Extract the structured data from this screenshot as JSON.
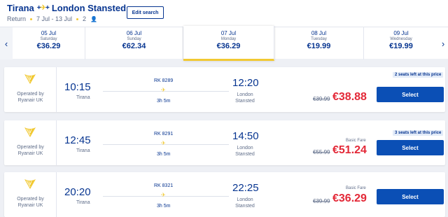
{
  "header": {
    "origin": "Tirana",
    "destination": "London Stansted",
    "trip_type": "Return",
    "dates": "7 Jul - 13 Jul",
    "passengers": "2",
    "edit_label": "Edit search"
  },
  "dates": [
    {
      "date": "05 Jul",
      "weekday": "Saturday",
      "price": "€36.29"
    },
    {
      "date": "06 Jul",
      "weekday": "Sunday",
      "price": "€62.34"
    },
    {
      "date": "07 Jul",
      "weekday": "Monday",
      "price": "€36.29",
      "active": true
    },
    {
      "date": "08 Jul",
      "weekday": "Tuesday",
      "price": "€19.99"
    },
    {
      "date": "09 Jul",
      "weekday": "Wednesday",
      "price": "€19.99"
    }
  ],
  "flights": [
    {
      "operated_line1": "Operated by",
      "operated_line2": "Ryanair UK",
      "dep_time": "10:15",
      "dep_city": "Tirana",
      "flight_no": "RK 8289",
      "duration": "3h 5m",
      "arr_time": "12:20",
      "arr_city": "London Stansted",
      "fare_label": "",
      "old_price": "€39.99",
      "new_price": "€38.88",
      "seats_left": "2 seats left at this price",
      "select_label": "Select"
    },
    {
      "operated_line1": "Operated by",
      "operated_line2": "Ryanair UK",
      "dep_time": "12:45",
      "dep_city": "Tirana",
      "flight_no": "RK 8291",
      "duration": "3h 5m",
      "arr_time": "14:50",
      "arr_city": "London Stansted",
      "fare_label": "Basic Fare",
      "old_price": "€55.99",
      "new_price": "€51.24",
      "seats_left": "3 seats left at this price",
      "select_label": "Select"
    },
    {
      "operated_line1": "Operated by",
      "operated_line2": "Ryanair UK",
      "dep_time": "20:20",
      "dep_city": "Tirana",
      "flight_no": "RK 8321",
      "duration": "3h 5m",
      "arr_time": "22:25",
      "arr_city": "London Stansted",
      "fare_label": "Basic Fare",
      "old_price": "€39.99",
      "new_price": "€36.29",
      "seats_left": "",
      "select_label": "Select"
    }
  ],
  "icons": {
    "nav_prev": "chevron-left-icon",
    "nav_next": "chevron-right-icon",
    "route": "plane-swap-icon",
    "flight": "plane-icon",
    "operator_logo": "ryanair-harp-logo",
    "passenger": "person-icon"
  },
  "colors": {
    "brand_blue": "#073590",
    "accent_yellow": "#f1c933",
    "price_red": "#e32837",
    "button_blue": "#0b4fb5"
  }
}
